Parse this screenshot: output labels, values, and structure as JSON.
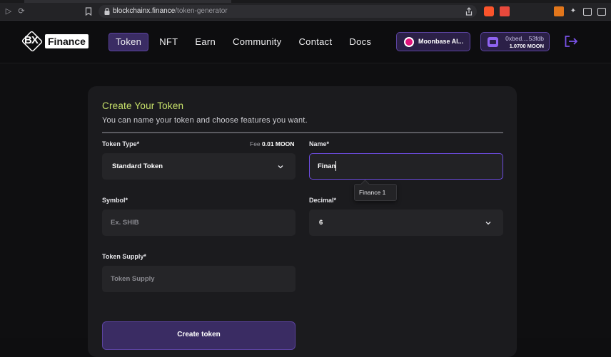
{
  "browser": {
    "url_host": "blockchainx.finance",
    "url_path": "/token-generator"
  },
  "site": {
    "logo_mark": "BX",
    "logo_word": "Finance",
    "nav": [
      {
        "label": "Token",
        "active": true
      },
      {
        "label": "NFT"
      },
      {
        "label": "Earn"
      },
      {
        "label": "Community"
      },
      {
        "label": "Contact"
      },
      {
        "label": "Docs"
      }
    ],
    "network_label": "Moonbase Al...",
    "wallet_address": "0xbed....53fdb",
    "wallet_balance": "1.0700 MOON"
  },
  "form": {
    "title": "Create Your Token",
    "subtitle": "You can name your token and choose features you want.",
    "token_type_label": "Token Type*",
    "fee_prefix": "Fee",
    "fee_value": "0.01 MOON",
    "token_type_value": "Standard Token",
    "name_label": "Name*",
    "name_value": "Finan",
    "name_suggestion": "Finance 1",
    "symbol_label": "Symbol*",
    "symbol_placeholder": "Ex. SHIB",
    "decimal_label": "Decimal*",
    "decimal_value": "6",
    "supply_label": "Token Supply*",
    "supply_placeholder": "Token Supply",
    "submit_label": "Create token"
  },
  "colors": {
    "accent": "#6d4ce0",
    "title": "#c8e26a",
    "card": "#1b1b1e"
  }
}
